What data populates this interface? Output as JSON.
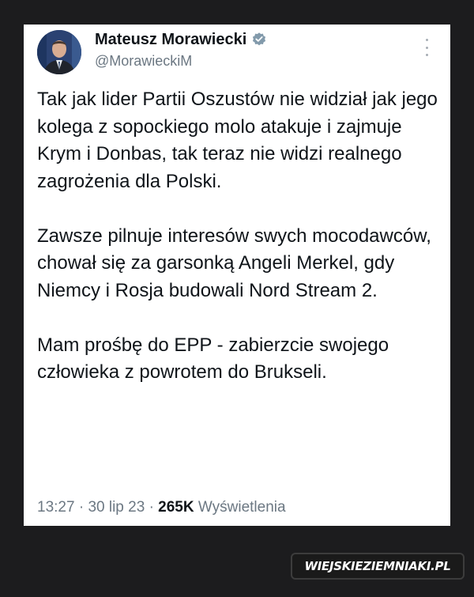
{
  "tweet": {
    "author": {
      "name": "Mateusz Morawiecki",
      "handle": "@MorawieckiM",
      "verified": true,
      "avatar_icon": "person-avatar"
    },
    "paragraphs": [
      "Tak jak lider Partii Oszustów nie widział jak jego kolega z sopockiego molo atakuje i zajmuje Krym i Donbas, tak teraz nie widzi realnego zagrożenia dla Polski.",
      "Zawsze pilnuje interesów swych mocodawców, chował się za garsonką Angeli Merkel, gdy Niemcy i Rosja budowali Nord Stream 2.",
      "Mam prośbę do EPP - zabierzcie swojego człowieka z powrotem do Brukseli."
    ],
    "time": "13:27",
    "separator": "·",
    "date": "30 lip 23",
    "views_count": "265K",
    "views_label": "Wyświetlenia"
  },
  "watermark": {
    "text": "WIEJSKIEZIEMNIAKI.PL"
  },
  "colors": {
    "background": "#1c1c1e",
    "card": "#ffffff",
    "text": "#0f1419",
    "secondary": "#6b7782",
    "verified": "#829aab"
  }
}
